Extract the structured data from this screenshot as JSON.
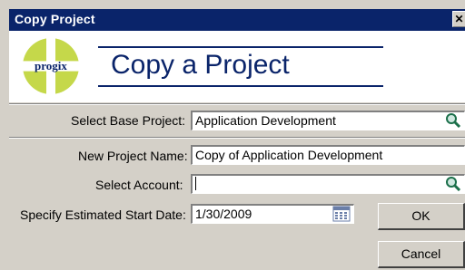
{
  "window": {
    "title": "Copy Project",
    "close_glyph": "✕"
  },
  "header": {
    "logo_text": "progix",
    "heading": "Copy a Project"
  },
  "form": {
    "base_project": {
      "label": "Select Base Project:",
      "value": "Application Development",
      "icon": "search-icon"
    },
    "new_name": {
      "label": "New Project Name:",
      "value": "Copy of Application Development"
    },
    "account": {
      "label": "Select Account:",
      "value": "",
      "icon": "search-icon"
    },
    "start_date": {
      "label": "Specify Estimated Start Date:",
      "value": "1/30/2009",
      "icon": "calendar-icon"
    }
  },
  "buttons": {
    "ok": "OK",
    "cancel": "Cancel"
  },
  "colors": {
    "title_bar": "#0a246a",
    "logo_green": "#c5d84a",
    "dialog_bg": "#d4d0c8"
  }
}
